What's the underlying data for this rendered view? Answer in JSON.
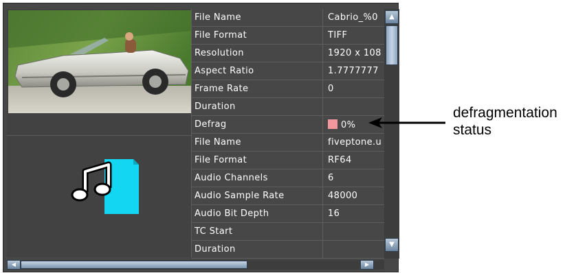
{
  "video_rows": [
    {
      "label": "File Name",
      "value": "Cabrio_%0"
    },
    {
      "label": "File Format",
      "value": "TIFF"
    },
    {
      "label": "Resolution",
      "value": "1920 x 108"
    },
    {
      "label": "Aspect Ratio",
      "value": "1.7777777"
    },
    {
      "label": "Frame Rate",
      "value": "0"
    },
    {
      "label": "Duration",
      "value": ""
    },
    {
      "label": "Defrag",
      "value": "0%"
    }
  ],
  "audio_rows": [
    {
      "label": "File Name",
      "value": "fiveptone.u"
    },
    {
      "label": "File Format",
      "value": "RF64"
    },
    {
      "label": "Audio Channels",
      "value": "6"
    },
    {
      "label": "Audio Sample Rate",
      "value": "48000"
    },
    {
      "label": "Audio Bit Depth",
      "value": "16"
    },
    {
      "label": "TC Start",
      "value": ""
    },
    {
      "label": "Duration",
      "value": ""
    }
  ],
  "defrag_color": "#f2979b",
  "callout": {
    "line1": "defragmentation",
    "line2": "status"
  },
  "icons": {
    "video": "car-video-thumbnail",
    "audio": "audio-file-icon"
  }
}
